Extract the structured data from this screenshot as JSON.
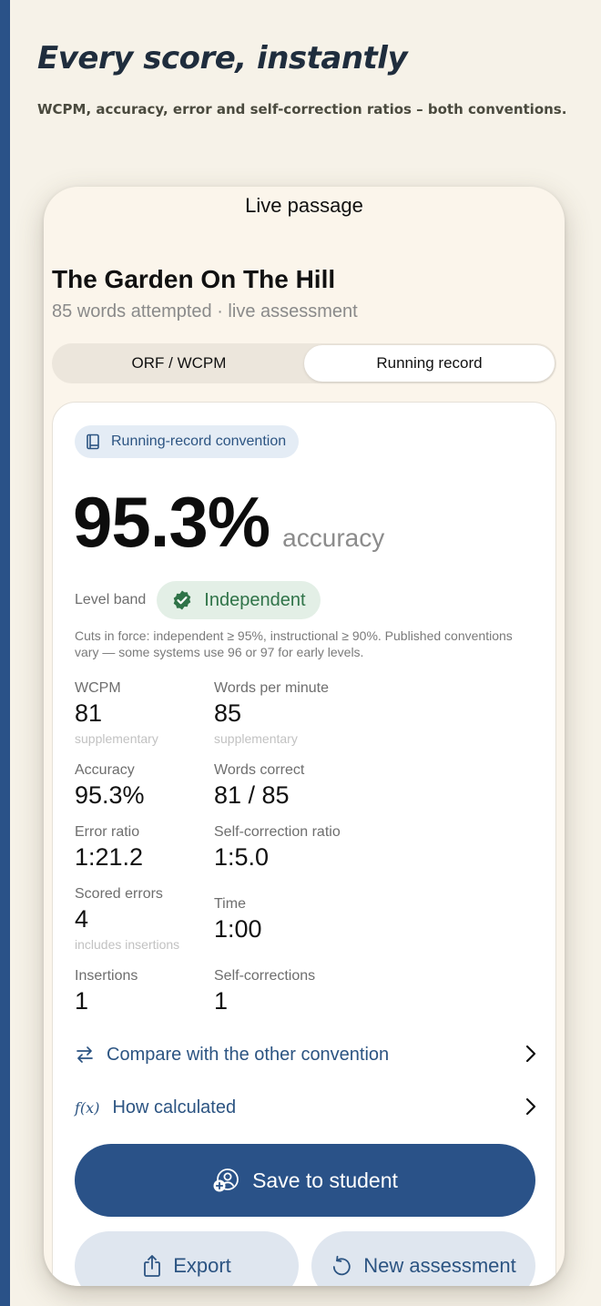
{
  "hero": {
    "title": "Every score, instantly",
    "subtitle": "WCPM, accuracy, error and self-correction ratios – both conventions."
  },
  "screen": {
    "header": "Live passage",
    "passage_title": "The Garden On The Hill",
    "passage_meta": "85 words attempted · live assessment",
    "tabs": [
      {
        "label": "ORF / WCPM",
        "active": false
      },
      {
        "label": "Running record",
        "active": true
      }
    ]
  },
  "card": {
    "convention_chip": "Running-record convention",
    "accuracy_value": "95.3%",
    "accuracy_unit": "accuracy",
    "level_band_label": "Level band",
    "level_band_value": "Independent",
    "cuts_note": "Cuts in force: independent ≥ 95%, instructional ≥ 90%. Published conventions vary — some systems use 96 or 97 for early levels.",
    "metrics": {
      "wcpm": {
        "label": "WCPM",
        "value": "81",
        "note": "supplementary"
      },
      "wpm": {
        "label": "Words per minute",
        "value": "85",
        "note": "supplementary"
      },
      "accuracy": {
        "label": "Accuracy",
        "value": "95.3%"
      },
      "words_correct": {
        "label": "Words correct",
        "value": "81 / 85"
      },
      "error_ratio": {
        "label": "Error ratio",
        "value": "1:21.2"
      },
      "sc_ratio": {
        "label": "Self-correction ratio",
        "value": "1:5.0"
      },
      "scored_errors": {
        "label": "Scored errors",
        "value": "4",
        "note": "includes insertions"
      },
      "time": {
        "label": "Time",
        "value": "1:00"
      },
      "insertions": {
        "label": "Insertions",
        "value": "1"
      },
      "self_corrections": {
        "label": "Self-corrections",
        "value": "1"
      }
    },
    "links": {
      "compare": "Compare with the other convention",
      "how_calculated": "How calculated",
      "fx_glyph": "f(x)"
    },
    "buttons": {
      "save": "Save to student",
      "export": "Export",
      "new_assessment": "New assessment"
    }
  },
  "colors": {
    "accent": "#2a5288",
    "success": "#2f7348",
    "background": "#f6f2e8"
  }
}
